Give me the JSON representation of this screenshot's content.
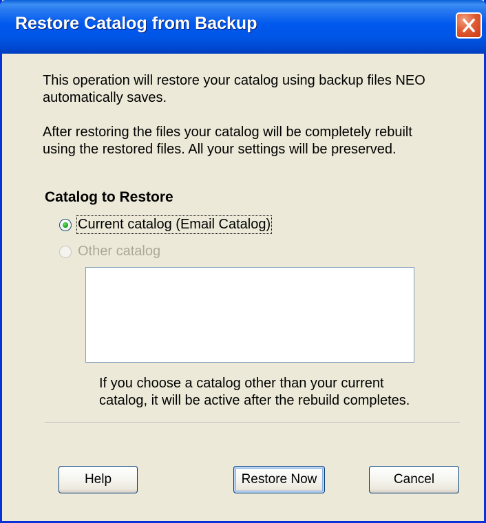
{
  "window": {
    "title": "Restore Catalog from Backup",
    "close_icon": "close-icon"
  },
  "intro": {
    "paragraph1_line1": "This operation will restore your catalog using backup files NEO",
    "paragraph1_line2": "automatically saves.",
    "paragraph2_line1": "After restoring the files your catalog will be completely rebuilt",
    "paragraph2_line2": "using the restored files. All your settings will be preserved."
  },
  "catalog_section": {
    "title": "Catalog to Restore",
    "options": [
      {
        "label": "Current catalog (Email Catalog)",
        "selected": true,
        "enabled": true
      },
      {
        "label": "Other catalog",
        "selected": false,
        "enabled": false
      }
    ],
    "note_line1": "If you choose a catalog other than your current",
    "note_line2": "catalog, it will be active after the rebuild completes."
  },
  "buttons": {
    "help": "Help",
    "restore_now": "Restore Now",
    "cancel": "Cancel"
  },
  "colors": {
    "titlebar": "#0055e5",
    "dialog_background": "#ece9d8",
    "close_button": "#e15c33",
    "radio_dot": "#21a121",
    "disabled_text": "#aca899"
  }
}
